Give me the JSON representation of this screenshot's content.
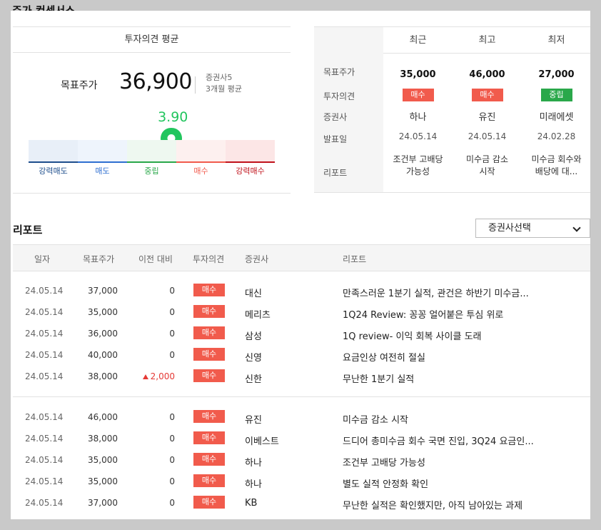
{
  "page_title": "주가 컨센서스",
  "summary": {
    "title": "투자의견 평균",
    "target_price_label": "목표주가",
    "target_price_value": "36,900",
    "brokers": "증권사5",
    "period": "3개월 평균",
    "score": "3.90",
    "score_fraction": 0.58,
    "gauge_labels": [
      "강력매도",
      "매도",
      "중립",
      "매수",
      "강력매수"
    ],
    "gauge_colors": [
      "#1e4e8c",
      "#2f6fd1",
      "#2aa84a",
      "#f15b4c",
      "#c0121b"
    ],
    "gauge_bg": [
      "#e8eff8",
      "#eef4fc",
      "#eef8f0",
      "#fdf0ef",
      "#fce6e6"
    ]
  },
  "recent": {
    "columns": [
      "최근",
      "최고",
      "최저"
    ],
    "row_labels": [
      "목표주가",
      "투자의견",
      "증권사",
      "발표일",
      "리포트"
    ],
    "items": [
      {
        "target": "35,000",
        "opinion": "매수",
        "opinion_type": "buy",
        "broker": "하나",
        "date": "24.05.14",
        "report_lines": [
          "조건부 고배당",
          "가능성"
        ]
      },
      {
        "target": "46,000",
        "opinion": "매수",
        "opinion_type": "buy",
        "broker": "유진",
        "date": "24.05.14",
        "report_lines": [
          "미수금 감소",
          "시작"
        ]
      },
      {
        "target": "27,000",
        "opinion": "중립",
        "opinion_type": "hold",
        "broker": "미래에셋",
        "date": "24.02.28",
        "report_lines": [
          "미수금 회수와",
          "배당에 대..."
        ]
      }
    ]
  },
  "reports": {
    "title": "리포트",
    "broker_select": "증권사선택",
    "headers": [
      "일자",
      "목표주가",
      "이전 대비",
      "투자의견",
      "증권사",
      "리포트"
    ],
    "group1": [
      {
        "date": "24.05.14",
        "target": "37,000",
        "change": "0",
        "up": false,
        "opinion": "매수",
        "broker": "대신",
        "report": "만족스러운 1분기 실적, 관건은 하반기 미수금..."
      },
      {
        "date": "24.05.14",
        "target": "35,000",
        "change": "0",
        "up": false,
        "opinion": "매수",
        "broker": "메리츠",
        "report": "1Q24 Review: 꽁꽁 얼어붙은 투심 위로"
      },
      {
        "date": "24.05.14",
        "target": "36,000",
        "change": "0",
        "up": false,
        "opinion": "매수",
        "broker": "삼성",
        "report": "1Q review- 이익 회복 사이클 도래"
      },
      {
        "date": "24.05.14",
        "target": "40,000",
        "change": "0",
        "up": false,
        "opinion": "매수",
        "broker": "신영",
        "report": "요금인상 여전히 절실"
      },
      {
        "date": "24.05.14",
        "target": "38,000",
        "change": "2,000",
        "up": true,
        "opinion": "매수",
        "broker": "신한",
        "report": "무난한 1분기 실적"
      }
    ],
    "group2": [
      {
        "date": "24.05.14",
        "target": "46,000",
        "change": "0",
        "up": false,
        "opinion": "매수",
        "broker": "유진",
        "report": "미수금 감소 시작"
      },
      {
        "date": "24.05.14",
        "target": "38,000",
        "change": "0",
        "up": false,
        "opinion": "매수",
        "broker": "이베스트",
        "report": "드디어 총미수금 회수 국면 진입, 3Q24 요금인..."
      },
      {
        "date": "24.05.14",
        "target": "35,000",
        "change": "0",
        "up": false,
        "opinion": "매수",
        "broker": "하나",
        "report": "조건부 고배당 가능성"
      },
      {
        "date": "24.05.14",
        "target": "35,000",
        "change": "0",
        "up": false,
        "opinion": "매수",
        "broker": "하나",
        "report": "별도 실적 안정화 확인"
      },
      {
        "date": "24.05.14",
        "target": "37,000",
        "change": "0",
        "up": false,
        "opinion": "매수",
        "broker": "KB",
        "report": "무난한 실적은 확인했지만, 아직 남아있는 과제"
      }
    ]
  }
}
